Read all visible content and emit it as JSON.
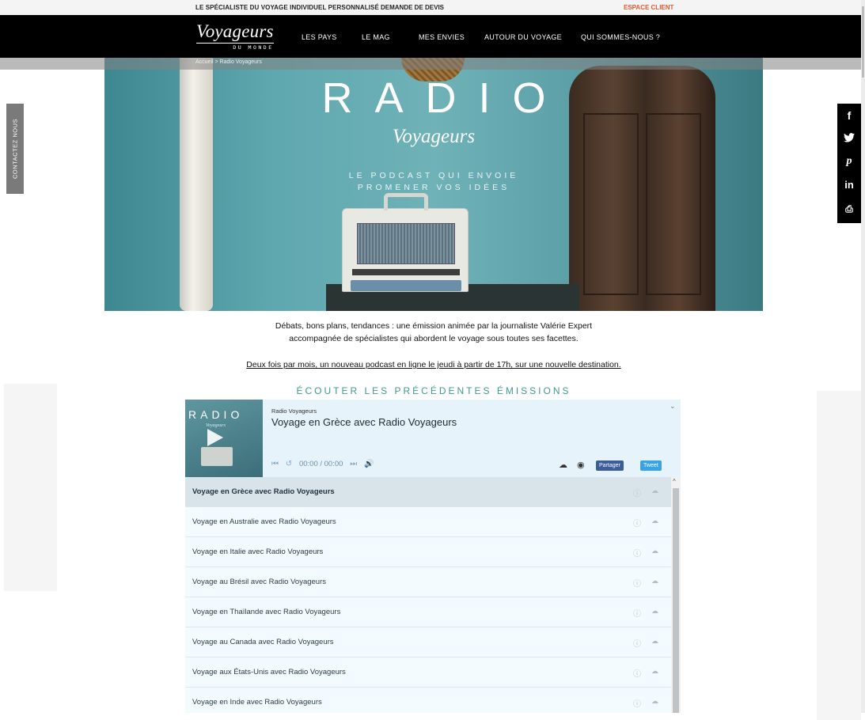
{
  "topbar": {
    "tagline": "LE SPÉCIALISTE DU VOYAGE INDIVIDUEL PERSONNALISÉ",
    "quote": "DEMANDE DE DEVIS",
    "client": "ESPACE CLIENT"
  },
  "logo": {
    "brand": "Voyageurs",
    "sub": "DU MONDE"
  },
  "nav": [
    "LES PAYS",
    "LE MAG",
    "MES ENVIES",
    "AUTOUR DU VOYAGE",
    "QUI SOMMES-NOUS ?"
  ],
  "breadcrumb": "Accueil > Radio Voyageurs",
  "hero": {
    "title": "RADIO",
    "subtitle": "Voyageurs",
    "tagline1": "LE PODCAST QUI ENVOIE",
    "tagline2": "PROMENER VOS IDÉES"
  },
  "contact_tab": "CONTACTEZ NOUS",
  "social": {
    "facebook": "f",
    "twitter": "🐦",
    "pinterest": "p",
    "linkedin": "in",
    "print": "⎙"
  },
  "intro": {
    "line1": "Débats, bons plans, tendances : une émission animée par la journaliste Valérie Expert",
    "line2": "accompagnée de spécialistes qui abordent le voyage sous toutes ses facettes.",
    "schedule": "Deux fois par mois, un nouveau podcast en ligne le jeudi à partir de 17h, sur une nouvelle destination."
  },
  "listen_heading": "ÉCOUTER LES PRÉCÉDENTES ÉMISSIONS",
  "player": {
    "cover_title": "RADIO",
    "cover_sub": "Voyageurs",
    "source": "Radio Voyageurs",
    "title": "Voyage en Grèce avec Radio Voyageurs",
    "time": "00:00 / 00:00",
    "share": "Partager",
    "tweet": "Tweet"
  },
  "playlist": [
    "Voyage en Grèce avec Radio Voyageurs",
    "Voyage en Australie avec Radio Voyageurs",
    "Voyage en Italie avec Radio Voyageurs",
    "Voyage au Brésil avec Radio Voyageurs",
    "Voyage en Thaïlande avec Radio Voyageurs",
    "Voyage au Canada avec Radio Voyageurs",
    "Voyage aux États-Unis avec Radio Voyageurs",
    "Voyage en Inde avec Radio Voyageurs"
  ],
  "colors": {
    "accent": "#3f9a8f",
    "client": "#e8582f",
    "facebook": "#3b5d9a",
    "twitter": "#3aa3e3"
  }
}
